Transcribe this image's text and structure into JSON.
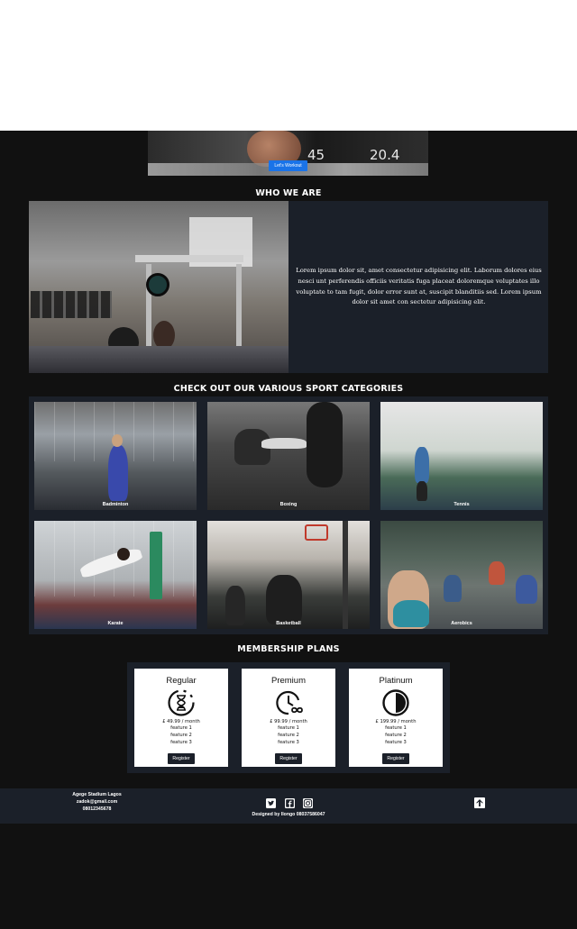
{
  "hero": {
    "button_label": "Let's Workout",
    "display_left": "45",
    "display_right": "20.4"
  },
  "who": {
    "title": "WHO WE ARE",
    "text": "Lorem ipsum dolor sit, amet consectetur adipisicing elit. Laborum dolores eius nesci unt perferendis officiis veritatis fuga placeat doloremque voluptates illo voluptate to tam fugit, dolor error sunt at, suscipit blanditiis sed. Lorem ipsum dolor sit amet con sectetur adipisicing elit."
  },
  "sports": {
    "title": "CHECK OUT OUR VARIOUS SPORT CATEGORIES",
    "items": [
      {
        "label": "Badminton"
      },
      {
        "label": "Boxing"
      },
      {
        "label": "Tennis"
      },
      {
        "label": "Karate"
      },
      {
        "label": "Basketball"
      },
      {
        "label": "Aerobics"
      }
    ]
  },
  "plans": {
    "title": "MEMBERSHIP PLANS",
    "items": [
      {
        "name": "Regular",
        "icon": "hourglass-icon",
        "price": "£ 49.99 / month",
        "features": [
          "feature 1",
          "feature 2",
          "feature 3"
        ],
        "button": "Register"
      },
      {
        "name": "Premium",
        "icon": "clock-infinity-icon",
        "price": "£ 99.99 / month",
        "features": [
          "feature 1",
          "feature 2",
          "feature 3"
        ],
        "button": "Register"
      },
      {
        "name": "Platinum",
        "icon": "half-circle-icon",
        "price": "£ 199.99 / month",
        "features": [
          "feature 1",
          "feature 2",
          "feature 3"
        ],
        "button": "Register"
      }
    ]
  },
  "footer": {
    "address": "Agege Stadium Lagos",
    "email": "zadok@gmail.com",
    "phone": "08012345678",
    "designed_by": "Designed by Ilongo 08037586047",
    "icons": [
      "twitter-icon",
      "facebook-icon",
      "instagram-icon",
      "arrow-up-icon"
    ]
  },
  "colors": {
    "background": "#111111",
    "panel": "#1b2029",
    "accent_button": "#1a73e8"
  }
}
